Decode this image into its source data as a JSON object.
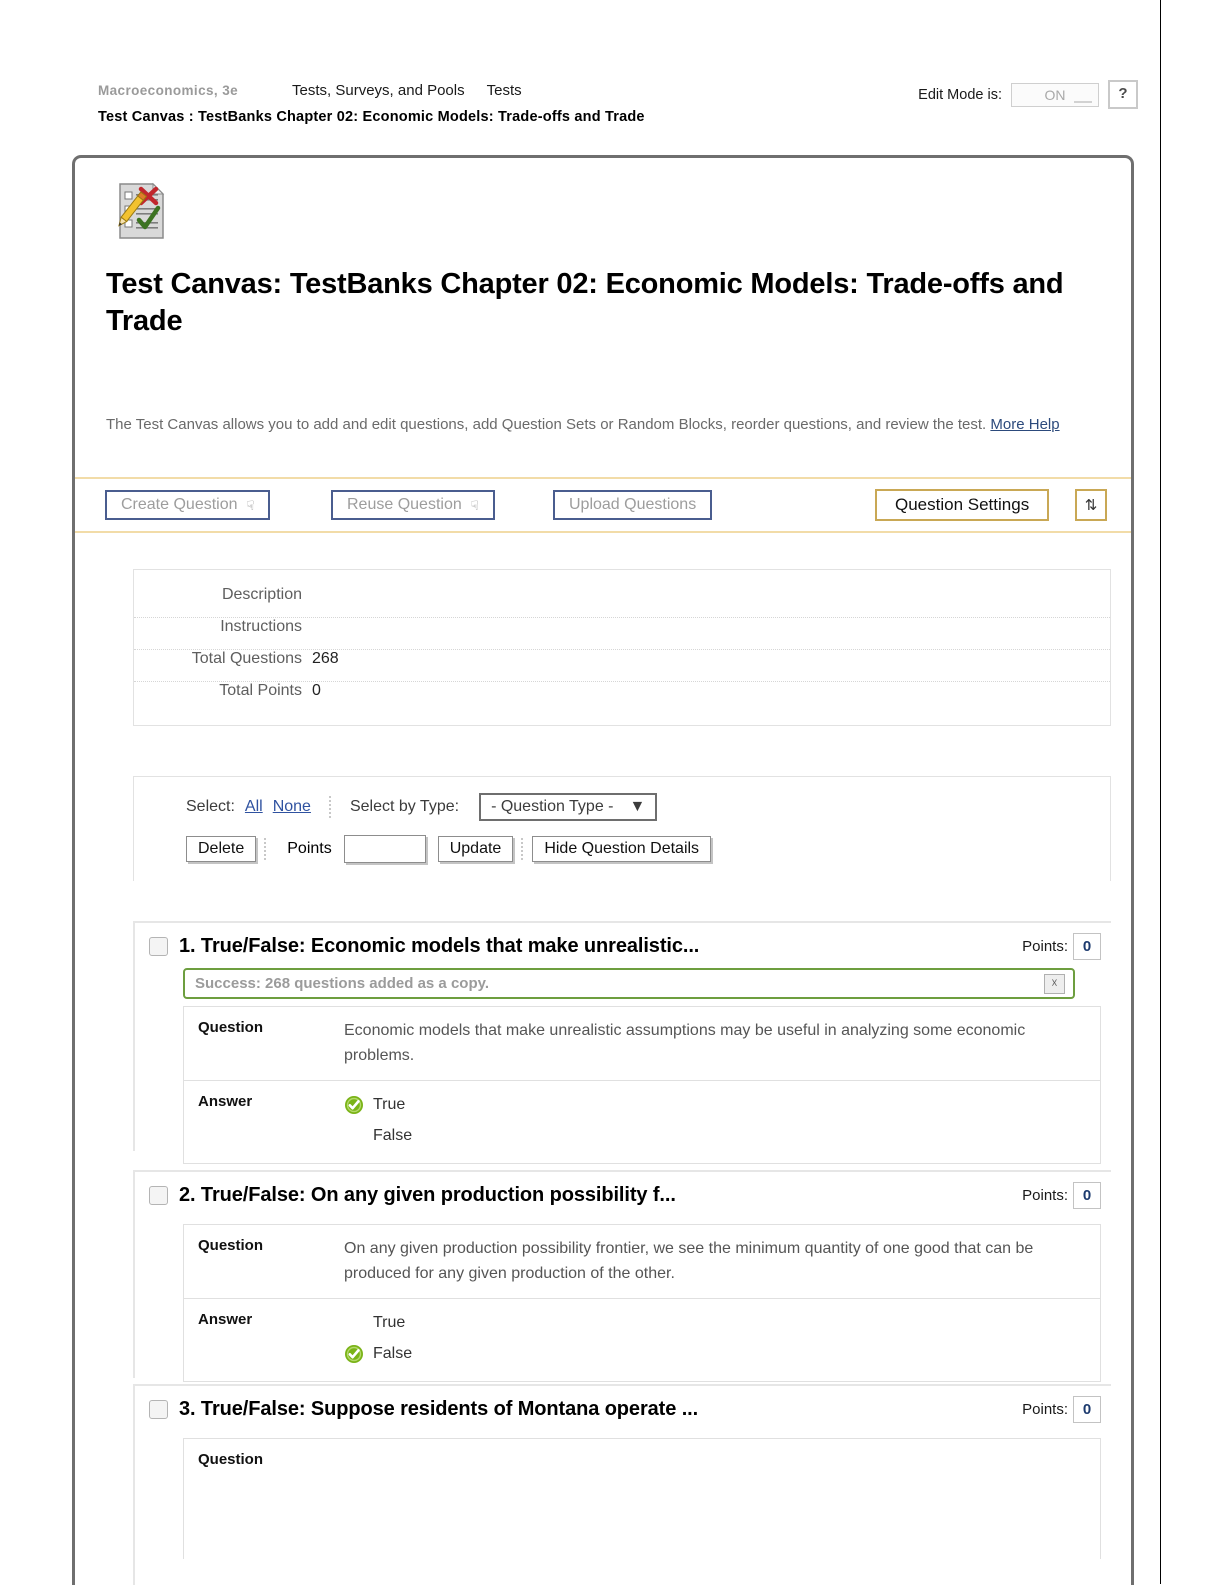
{
  "breadcrumb": {
    "course": "Macroeconomics, 3e",
    "section": "Tests, Surveys, and Pools",
    "subsection": "Tests",
    "current": "Test Canvas : TestBanks Chapter 02: Economic Models: Trade-offs and Trade"
  },
  "edit_mode": {
    "label": "Edit Mode is:",
    "value": "ON",
    "help": "?"
  },
  "page": {
    "title": "Test Canvas: TestBanks Chapter 02: Economic Models: Trade-offs and Trade",
    "description": "The Test Canvas allows you to add and edit questions, add Question Sets or Random Blocks, reorder questions, and review the test.",
    "more_help": "More Help",
    "icon": "test-canvas-icon"
  },
  "toolbar": {
    "create_question": "Create Question",
    "reuse_question": "Reuse Question",
    "upload_questions": "Upload Questions",
    "question_settings": "Question Settings",
    "reorder_icon": "sort-updown-icon",
    "chevron_icon": "chevron-double-down-icon"
  },
  "summary": {
    "rows": [
      {
        "label": "Description",
        "value": ""
      },
      {
        "label": "Instructions",
        "value": ""
      },
      {
        "label": "Total Questions",
        "value": "268"
      },
      {
        "label": "Total Points",
        "value": "0"
      }
    ]
  },
  "select_bar": {
    "select_label": "Select:",
    "all": "All",
    "none": "None",
    "select_by_type_label": "Select by Type:",
    "question_type_value": "- Question Type -",
    "delete": "Delete",
    "points_label": "Points",
    "points_value": "",
    "update": "Update",
    "hide_details": "Hide Question Details"
  },
  "notification": {
    "text": "Success: 268 questions added as a copy.",
    "close_icon": "close-icon"
  },
  "labels": {
    "points": "Points:",
    "question": "Question",
    "answer": "Answer"
  },
  "questions": [
    {
      "title": "1. True/False: Economic models that make unrealistic...",
      "points": "0",
      "question_text": "Economic models that make unrealistic assumptions may be useful in analyzing some economic problems.",
      "answers": [
        {
          "text": "True",
          "correct": true
        },
        {
          "text": "False",
          "correct": false
        }
      ]
    },
    {
      "title": "2. True/False: On any given production possibility f...",
      "points": "0",
      "question_text": "On any given production possibility frontier, we see the minimum quantity of one good that can be produced for any given production of the other.",
      "answers": [
        {
          "text": "True",
          "correct": false
        },
        {
          "text": "False",
          "correct": true
        }
      ]
    },
    {
      "title": "3. True/False: Suppose residents of Montana operate ...",
      "points": "0",
      "question_text": "",
      "answers": []
    }
  ],
  "colors": {
    "accent_gold": "#c9a855",
    "button_blue": "#4a5d8f",
    "success_green": "#6d9e3f",
    "link_blue": "#2f52a0"
  }
}
